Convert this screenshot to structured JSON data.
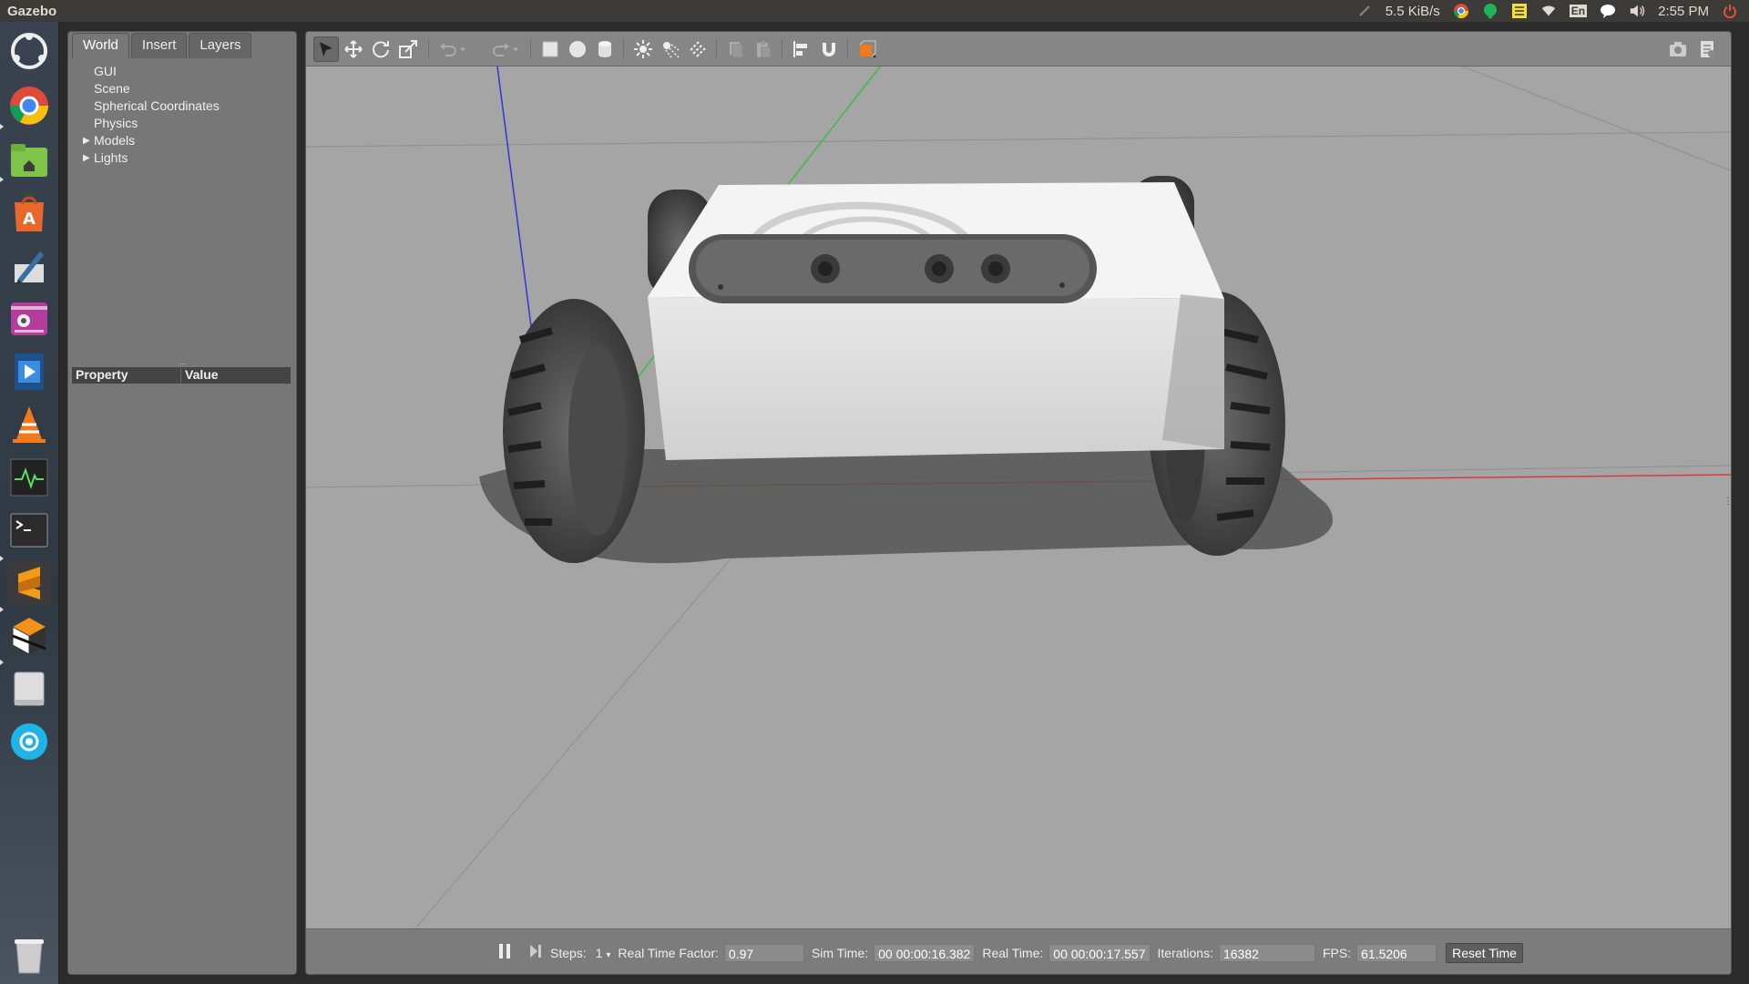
{
  "topbar": {
    "app_title": "Gazebo",
    "net_speed": "5.5 KiB/s",
    "keyboard": "En",
    "clock": "2:55 PM"
  },
  "launcher": {
    "items": [
      "ubuntu-dash-icon",
      "chrome-icon",
      "files-icon",
      "software-center-icon",
      "text-editor-icon",
      "camera-app-icon",
      "video-editor-icon",
      "vlc-icon",
      "system-monitor-icon",
      "terminal-icon",
      "sublime-text-icon",
      "gazebo-icon",
      "disk-drive-icon",
      "app-icon",
      "trash-icon"
    ]
  },
  "left_panel": {
    "tabs": [
      {
        "label": "World",
        "active": true
      },
      {
        "label": "Insert",
        "active": false
      },
      {
        "label": "Layers",
        "active": false
      }
    ],
    "tree": [
      {
        "label": "GUI",
        "expandable": false
      },
      {
        "label": "Scene",
        "expandable": false
      },
      {
        "label": "Spherical Coordinates",
        "expandable": false
      },
      {
        "label": "Physics",
        "expandable": false
      },
      {
        "label": "Models",
        "expandable": true
      },
      {
        "label": "Lights",
        "expandable": true
      }
    ],
    "property_header": {
      "property": "Property",
      "value": "Value"
    }
  },
  "toolbar": {
    "tools": [
      "select-tool-icon",
      "translate-tool-icon",
      "rotate-tool-icon",
      "scale-tool-icon",
      "undo-icon",
      "undo-dropdown-icon",
      "redo-icon",
      "redo-dropdown-icon",
      "box-shape-icon",
      "sphere-shape-icon",
      "cylinder-shape-icon",
      "point-light-icon",
      "spot-light-icon",
      "directional-light-icon",
      "copy-icon",
      "paste-icon",
      "align-icon",
      "snap-icon",
      "view-angle-icon"
    ],
    "right_tools": [
      "screenshot-icon",
      "log-icon"
    ]
  },
  "statusbar": {
    "steps_label": "Steps:",
    "steps_value": "1",
    "rtf_label": "Real Time Factor:",
    "rtf_value": "0.97",
    "sim_time_label": "Sim Time:",
    "sim_time_value": "00 00:00:16.382",
    "real_time_label": "Real Time:",
    "real_time_value": "00 00:00:17.557",
    "iterations_label": "Iterations:",
    "iterations_value": "16382",
    "fps_label": "FPS:",
    "fps_value": "61.5206",
    "reset_label": "Reset Time"
  },
  "colors": {
    "topbar_bg": "#3c3b37",
    "panel_bg": "#777777",
    "viewport_bg": "#a6a6a6",
    "axis_x": "#d23c3c",
    "axis_y": "#3cbe3c",
    "axis_z": "#3232e6"
  }
}
